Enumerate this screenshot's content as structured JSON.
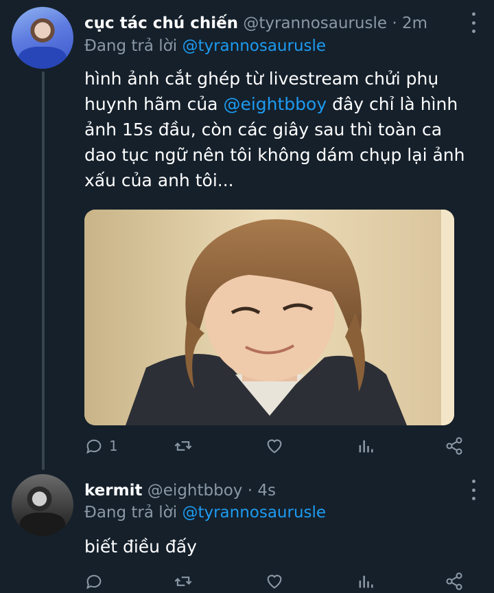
{
  "tweet1": {
    "name": "cục tác chú chiến",
    "handle": "@tyrannosaurusle",
    "time": "2m",
    "replying_prefix": "Đang trả lời",
    "replying_to": "@tyrannosaurusle",
    "text_part1": "hình ảnh cắt ghép từ livestream chửi phụ huynh hãm của",
    "text_mention": "@eightbboy",
    "text_part2": "đây chỉ là hình ảnh 15s đầu, còn các giây sau thì toàn ca dao tục ngữ nên tôi không dám chụp lại ảnh xấu của anh tôi...",
    "reply_count": "1"
  },
  "tweet2": {
    "name": "kermit",
    "handle": "@eightbboy",
    "time": "4s",
    "replying_prefix": "Đang trả lời",
    "replying_to": "@tyrannosaurusle",
    "text": "biết điều đấy",
    "reply_count": ""
  },
  "separator": "·",
  "icons": {
    "reply": "reply-icon",
    "retweet": "retweet-icon",
    "like": "heart-icon",
    "analytics": "analytics-icon",
    "share": "share-icon",
    "more": "more-vertical-icon"
  },
  "colors": {
    "background": "#15202b",
    "accent": "#1d9bf0",
    "secondary_text": "#8b98a5"
  }
}
